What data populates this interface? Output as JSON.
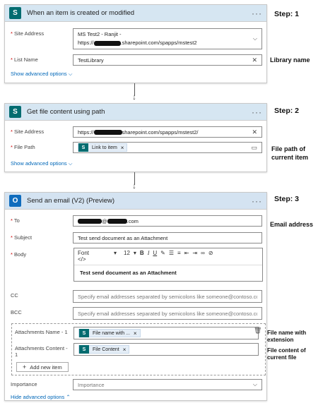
{
  "steps": {
    "step1": "Step: 1",
    "step2": "Step: 2",
    "step3": "Step: 3"
  },
  "annotations": {
    "library_name": "Library name",
    "file_path_1": "File path of",
    "file_path_2": "current item",
    "email_address": "Email address",
    "file_name_1": "File name with",
    "file_name_2": "extension",
    "file_content_1": "File content of",
    "file_content_2": "current file"
  },
  "card1": {
    "title": "When an item is created or modified",
    "site_label": "Site Address",
    "site_value_line1": "MS Test2 - Ranjit -",
    "site_value_prefix": "https://",
    "site_value_suffix": ".sharepoint.com/spapps/mstest2",
    "list_label": "List Name",
    "list_value": "TestLibrary",
    "advanced": "Show advanced options"
  },
  "card2": {
    "title": "Get file content using path",
    "site_label": "Site Address",
    "site_value_prefix": "https://",
    "site_value_suffix": "sharepoint.com/spapps/mstest2/",
    "path_label": "File Path",
    "path_token": "Link to item",
    "advanced": "Show advanced options"
  },
  "card3": {
    "title": "Send an email (V2) (Preview)",
    "to_label": "To",
    "to_value_suffix": "@",
    "to_value_domain": ".com",
    "subject_label": "Subject",
    "subject_value": "Test send document as an Attachment",
    "body_label": "Body",
    "font_name": "Font",
    "font_size": "12",
    "body_text": "Test send document as an Attachment",
    "cc_label": "CC",
    "cc_placeholder": "Specify email addresses separated by semicolons like someone@contoso.com",
    "bcc_label": "BCC",
    "bcc_placeholder": "Specify email addresses separated by semicolons like someone@contoso.com",
    "attach_name_label": "Attachments Name - 1",
    "attach_name_token": "File name with ...",
    "attach_content_label_1": "Attachments Content -",
    "attach_content_label_2": "1",
    "attach_content_token": "File Content",
    "add_item": "Add new item",
    "importance_label": "Importance",
    "importance_value": "Importance",
    "advanced": "Hide advanced options"
  },
  "colors": {
    "sharepoint": "#036c70",
    "outlook": "#0f6cbd",
    "link": "#0067b8",
    "required": "#c00000"
  }
}
